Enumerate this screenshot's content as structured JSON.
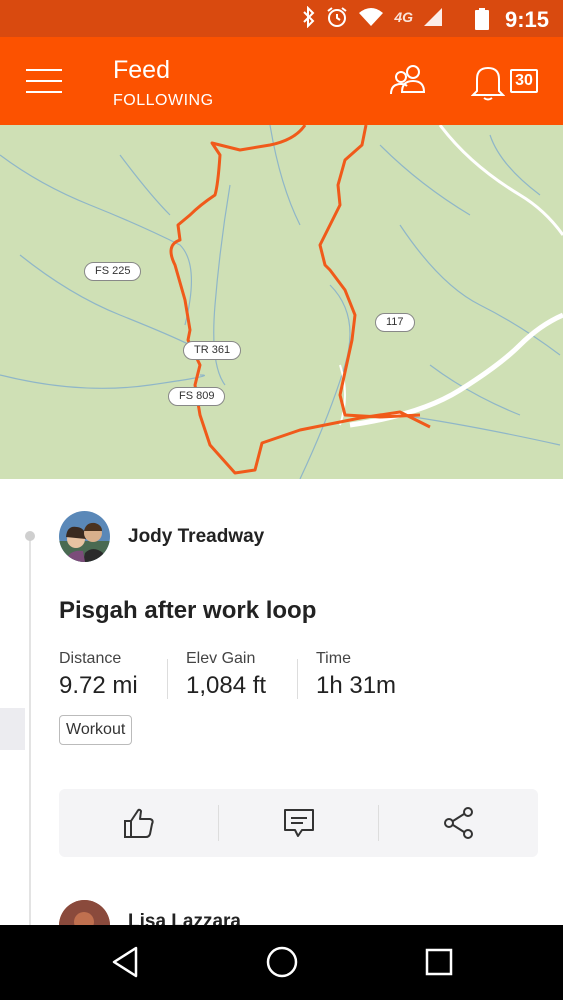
{
  "status_bar": {
    "time": "9:15",
    "network": "4G",
    "icons": [
      "bluetooth-icon",
      "alarm-icon",
      "wifi-icon",
      "signal-icon",
      "battery-icon"
    ]
  },
  "header": {
    "title": "Feed",
    "subtitle": "FOLLOWING",
    "notification_count": "30",
    "brand_color": "#fc5200"
  },
  "map": {
    "road_labels": [
      "FS 225",
      "117",
      "TR 361",
      "FS 809"
    ],
    "route_color": "#f05a1a"
  },
  "activity": {
    "athlete_name": "Jody Treadway",
    "title": "Pisgah after work loop",
    "stats": [
      {
        "label": "Distance",
        "value": "9.72 mi"
      },
      {
        "label": "Elev Gain",
        "value": "1,084 ft"
      },
      {
        "label": "Time",
        "value": "1h 31m"
      }
    ],
    "tag": "Workout"
  },
  "next_activity": {
    "athlete_name": "Lisa Lazzara"
  },
  "nav_bar": {
    "buttons": [
      "back-icon",
      "home-icon",
      "recents-icon"
    ]
  }
}
